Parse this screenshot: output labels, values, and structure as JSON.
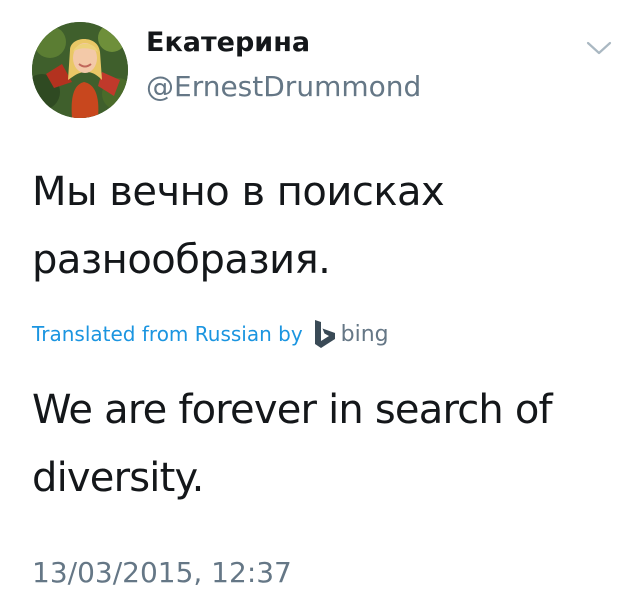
{
  "tweet": {
    "display_name": "Екатерина",
    "handle": "@ErnestDrummond",
    "text": "Мы вечно в поисках разнообразия.",
    "translation_label": "Translated from Russian by",
    "translation_provider": "bing",
    "translation": "We are forever in search of diversity.",
    "timestamp": "13/03/2015, 12:37"
  },
  "icons": {
    "menu": "chevron-down-icon",
    "provider": "bing-logo-icon"
  },
  "colors": {
    "text": "#14171a",
    "secondary": "#657786",
    "link": "#1b95e0",
    "caret": "#aab8c2"
  }
}
